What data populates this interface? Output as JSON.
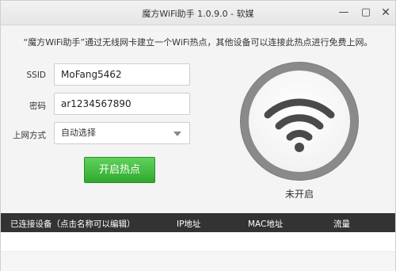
{
  "window": {
    "title": "魔方WiFi助手 1.0.9.0 - 软媒",
    "minimize_icon": "minimize-icon",
    "maximize_icon": "maximize-icon",
    "close_icon": "close-icon"
  },
  "description": "“魔方WiFi助手”通过无线网卡建立一个WiFi热点，其他设备可以连接此热点进行免费上网。",
  "form": {
    "ssid_label": "SSID",
    "ssid_value": "MoFang5462",
    "password_label": "密码",
    "password_value": "ar1234567890",
    "mode_label": "上网方式",
    "mode_value": "自动选择",
    "start_button": "开启热点"
  },
  "hotspot": {
    "icon": "wifi-icon",
    "status": "未开启"
  },
  "devices_table": {
    "columns": [
      "已连接设备（点击名称可以编辑）",
      "IP地址",
      "MAC地址",
      "流量"
    ],
    "rows": []
  },
  "colors": {
    "accent_green": "#3cb83a",
    "header_dark": "#333333",
    "circle_gray": "#8a8a8a",
    "wifi_symbol": "#4a4a4a"
  }
}
